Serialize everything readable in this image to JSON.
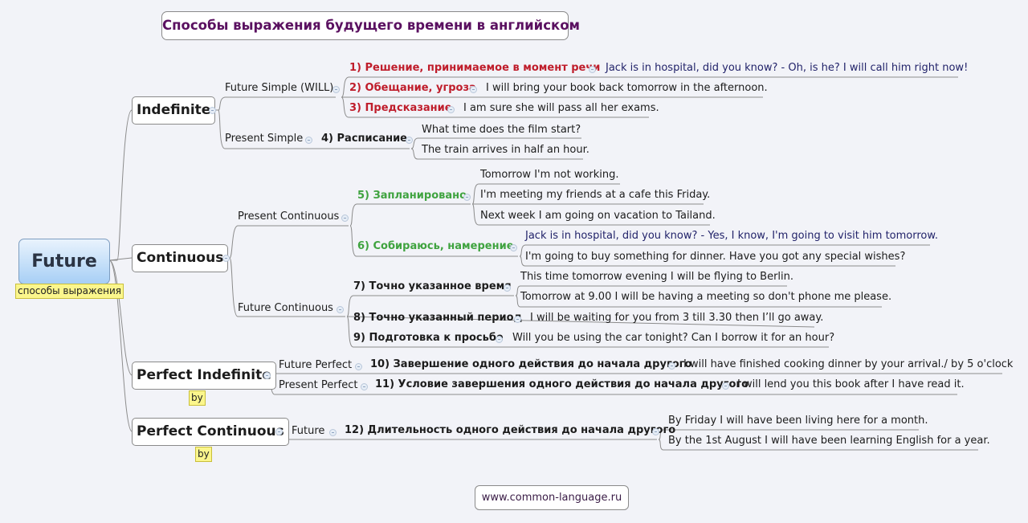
{
  "title": "Способы выражения будущего времени в английском",
  "root": {
    "label": "Future",
    "note": "способы выражения"
  },
  "footer": "www.common-language.ru",
  "colors": {
    "decision_red": "#bf1d2b",
    "plan_green": "#3fa33f",
    "title_purple": "#5a1060",
    "example_blue": "#22236a",
    "note_yellow": "#fbf68c"
  },
  "branches": {
    "indefinite": {
      "label": "Indefinite",
      "future_simple": {
        "label": "Future Simple (WILL)",
        "items": [
          {
            "category": "1) Решение, принимаемое в момент речи",
            "example": "Jack is in hospital, did you know? - Oh, is he? I will call him right now!"
          },
          {
            "category": "2) Обещание, угроза",
            "example": "I will bring your book back tomorrow in the afternoon."
          },
          {
            "category": "3) Предсказание",
            "example": "I am sure she will pass all her exams."
          }
        ]
      },
      "present_simple": {
        "label": "Present Simple",
        "category": "4) Расписание",
        "examples": [
          "What time does the film start?",
          "The train arrives in half an hour."
        ]
      }
    },
    "continuous": {
      "label": "Continuous",
      "present_continuous": {
        "label": "Present Continuous",
        "planned": {
          "category": "5) Запланировано",
          "examples": [
            "Tomorrow I'm not working.",
            "I'm meeting my friends at a cafe this Friday.",
            "Next week I am going on vacation to Tailand."
          ]
        },
        "intention": {
          "category": "6) Собираюсь, намерение",
          "examples": [
            "Jack is in hospital, did you know? - Yes, I know, I'm going to visit him tomorrow.",
            "I'm going to buy something for dinner. Have you got any special wishes?"
          ]
        }
      },
      "future_continuous": {
        "label": "Future Continuous",
        "exact_time": {
          "category": "7) Точно указанное время",
          "examples": [
            "This time tomorrow evening I will be flying to Berlin.",
            "Tomorrow at 9.00 I will be having a meeting so don't phone me please."
          ]
        },
        "exact_period": {
          "category": "8) Точно указанный период",
          "example": "I will be waiting for you from 3 till 3.30 then I’ll go away."
        },
        "request_prep": {
          "category": "9) Подготовка к просьбе",
          "example": "Will you be using the car tonight? Can I borrow it for an hour?"
        }
      }
    },
    "perfect_indefinite": {
      "label": "Perfect Indefinite",
      "note": "by",
      "future_perfect": {
        "label": "Future Perfect",
        "category": "10) Завершение одного действия до начала другого",
        "example": "I will have finished cooking dinner by your arrival./ by 5 o'clock"
      },
      "present_perfect": {
        "label": "Present Perfect",
        "category": "11) Условие завершения одного действия до начала другого",
        "example": "I will lend you this book after I have read it."
      }
    },
    "perfect_continuous": {
      "label": "Perfect Continuous",
      "note": "by",
      "future": {
        "label": "Future",
        "category": "12) Длительность одного действия до начала другого",
        "examples": [
          "By Friday I will have been living here for a month.",
          "By the 1st August I will have been learning English for a year."
        ]
      }
    }
  }
}
